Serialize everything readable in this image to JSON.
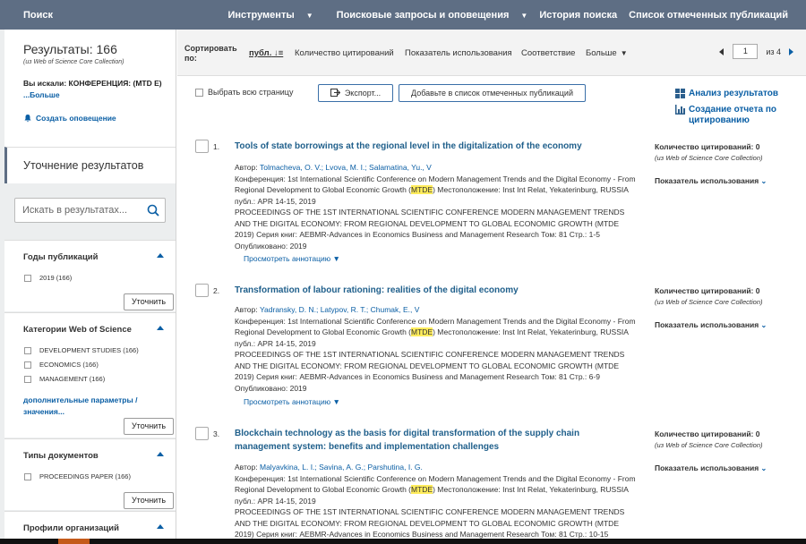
{
  "topbar": {
    "search": "Поиск",
    "nav": [
      "Инструменты",
      "Поисковые запросы и оповещения",
      "История поиска",
      "Список отмеченных публикаций"
    ]
  },
  "results": {
    "title": "Результаты: 166",
    "source": "(из Web of Science Core Collection)",
    "searched_label": "Вы искали:",
    "searched_value": "КОНФЕРЕНЦИЯ: (MTD E)",
    "more": "...Больше",
    "alert": "Создать оповещение"
  },
  "refine": {
    "title": "Уточнение результатов",
    "search_placeholder": "Искать в результатах..."
  },
  "panels": {
    "years": {
      "title": "Годы публикаций",
      "items": [
        "2019 (166)"
      ],
      "button": "Уточнить"
    },
    "categories": {
      "title": "Категории Web of Science",
      "items": [
        "DEVELOPMENT STUDIES (166)",
        "ECONOMICS (166)",
        "MANAGEMENT (166)"
      ],
      "more": "дополнительные параметры / значения...",
      "button": "Уточнить"
    },
    "doctypes": {
      "title": "Типы документов",
      "items": [
        "PROCEEDINGS PAPER (166)"
      ],
      "button": "Уточнить"
    },
    "orgs": {
      "title": "Профили организаций"
    }
  },
  "sort": {
    "label": "Сортировать по:",
    "options": [
      "публ.",
      "Количество цитирований",
      "Показатель использования",
      "Соответствие",
      "Больше"
    ],
    "page": "1",
    "of": "из 4"
  },
  "toolbar": {
    "select_all": "Выбрать всю страницу",
    "export": "Экспорт...",
    "add_list": "Добавьте в список отмеченных публикаций",
    "analyze": "Анализ результатов",
    "citation_report": "Создание отчета по цитированию"
  },
  "records": [
    {
      "num": "1.",
      "title": "Tools of state borrowings at the regional level in the digitalization of the economy",
      "authors_label": "Автор:",
      "authors": "Tolmacheva, O. V.; Lvova, M. I.; Salamatina, Yu., V",
      "conf_a": "Конференция: 1st International Scientific Conference on Modern Management Trends and the Digital Economy - From Regional Development to Global Economic Growth (",
      "conf_hl": "MTDE",
      "conf_b": ") Местоположение: Inst Int Relat, Yekaterinburg, RUSSIA публ.: APR 14-15, 2019",
      "proc": "PROCEEDINGS OF THE 1ST INTERNATIONAL SCIENTIFIC CONFERENCE MODERN MANAGEMENT TRENDS AND THE DIGITAL ECONOMY: FROM REGIONAL DEVELOPMENT TO GLOBAL ECONOMIC GROWTH (MTDE 2019)   Серия книг: AEBMR-Advances in Economics Business and Management Research   Том: 81   Стр.: 1-5   Опубликовано: 2019",
      "abstract": "Просмотреть аннотацию",
      "cites": "Количество цитирований: 0",
      "note": "(из Web of Science Core Collection)",
      "usage": "Показатель использования"
    },
    {
      "num": "2.",
      "title": "Transformation of labour rationing: realities of the digital economy",
      "authors_label": "Автор:",
      "authors": "Yadransky, D. N.; Latypov, R. T.; Chumak, E., V",
      "conf_a": "Конференция: 1st International Scientific Conference on Modern Management Trends and the Digital Economy - From Regional Development to Global Economic Growth (",
      "conf_hl": "MTDE",
      "conf_b": ") Местоположение: Inst Int Relat, Yekaterinburg, RUSSIA публ.: APR 14-15, 2019",
      "proc": "PROCEEDINGS OF THE 1ST INTERNATIONAL SCIENTIFIC CONFERENCE MODERN MANAGEMENT TRENDS AND THE DIGITAL ECONOMY: FROM REGIONAL DEVELOPMENT TO GLOBAL ECONOMIC GROWTH (MTDE 2019)   Серия книг: AEBMR-Advances in Economics Business and Management Research   Том: 81   Стр.: 6-9   Опубликовано: 2019",
      "abstract": "Просмотреть аннотацию",
      "cites": "Количество цитирований: 0",
      "note": "(из Web of Science Core Collection)",
      "usage": "Показатель использования"
    },
    {
      "num": "3.",
      "title": "Blockchain technology as the basis for digital transformation of the supply chain management system: benefits and implementation challenges",
      "authors_label": "Автор:",
      "authors": "Malyavkina, L. I.; Savina, A. G.; Parshutina, I. G.",
      "conf_a": "Конференция: 1st International Scientific Conference on Modern Management Trends and the Digital Economy - From Regional Development to Global Economic Growth (",
      "conf_hl": "MTDE",
      "conf_b": ") Местоположение: Inst Int Relat, Yekaterinburg, RUSSIA публ.: APR 14-15, 2019",
      "proc": "PROCEEDINGS OF THE 1ST INTERNATIONAL SCIENTIFIC CONFERENCE MODERN MANAGEMENT TRENDS AND THE DIGITAL ECONOMY: FROM REGIONAL DEVELOPMENT TO GLOBAL ECONOMIC GROWTH (MTDE 2019)   Серия книг: AEBMR-Advances in Economics Business and Management Research   Том: 81   Стр.: 10-15",
      "abstract": "",
      "cites": "Количество цитирований: 0",
      "note": "(из Web of Science Core Collection)",
      "usage": "Показатель использования"
    }
  ]
}
